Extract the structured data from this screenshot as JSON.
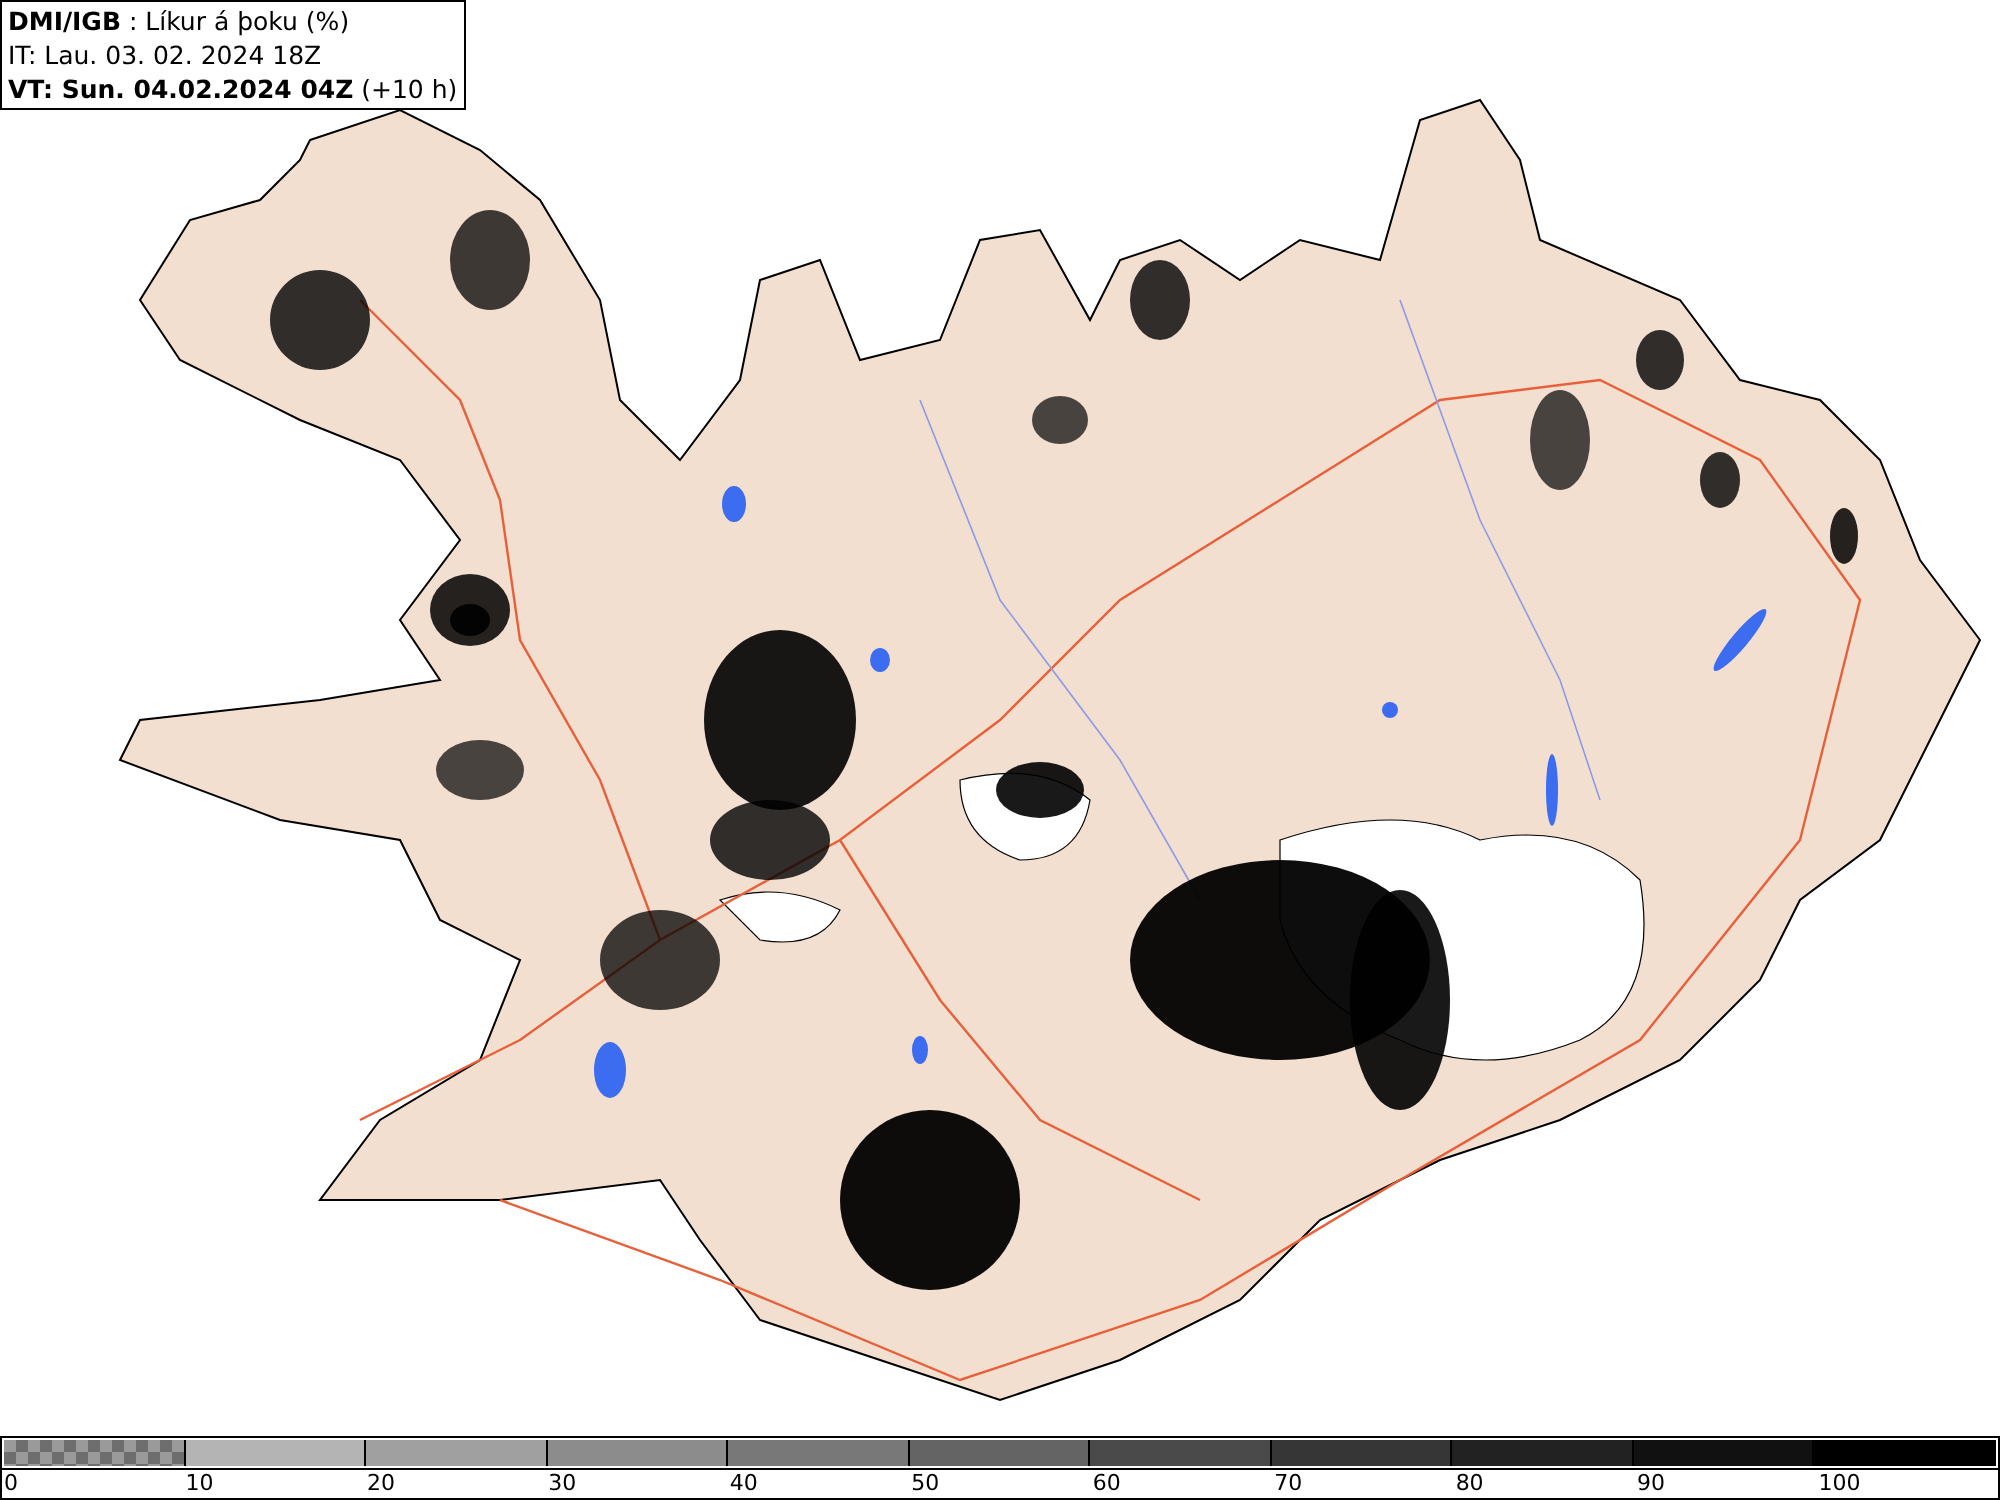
{
  "header": {
    "lines": [
      "**DMI/IGB** : Líkur á þoku (%)",
      "IT: Lau. 03. 02. 2024 18Z",
      "**VT: Sun. 04.02.2024 04Z** (+10 h)"
    ]
  },
  "legend": {
    "bins": [
      {
        "kind": "checker"
      },
      {
        "kind": "solid",
        "color": "#b4b4b4"
      },
      {
        "kind": "solid",
        "color": "#a0a0a0"
      },
      {
        "kind": "solid",
        "color": "#8c8c8c"
      },
      {
        "kind": "solid",
        "color": "#787878"
      },
      {
        "kind": "solid",
        "color": "#646464"
      },
      {
        "kind": "solid",
        "color": "#4a4a4a"
      },
      {
        "kind": "solid",
        "color": "#363636"
      },
      {
        "kind": "solid",
        "color": "#222222"
      },
      {
        "kind": "solid",
        "color": "#111111"
      },
      {
        "kind": "solid",
        "color": "#000000"
      }
    ],
    "labels": [
      "0",
      "10",
      "20",
      "30",
      "40",
      "50",
      "60",
      "70",
      "80",
      "90",
      "100"
    ]
  }
}
